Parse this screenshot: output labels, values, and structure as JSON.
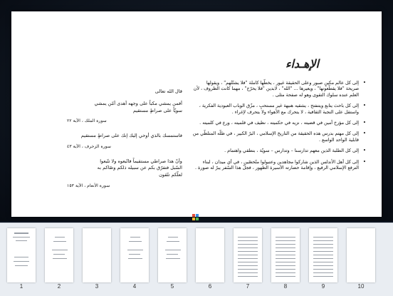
{
  "viewer": {
    "heading": "الإهـداء",
    "dedications": [
      "إلى كل عالم مكينٍ صبور وعلى الحقيقة غيور ، يخطّها كاملة \"فلا يشتّتُهم\" ، ويقولها صريحة \"فلا يقطّعونها\" ، ويعيرها ... \"الله\" ، لابدين \"فلا يحرّج\" ، مهما كانت الظروف ، لأن العلم عنده سلوك التقوى وهو له صفحة مثلى .",
      "إلى كل باحث يتابع ويتنفتح ، يشقيه هنيهة غير مستحبٍ ، مزّق الوباب العبودية الفكرية ، واستقل على النجبة الثقافية ، لا يتحرك مع الأهواء ولا يتحرف لإغراء .",
      "إلى كل مؤرخ أمين في قضيته ، نزيه في حكميته ، نظيف في قلميته ، ورع في كلميته .",
      "إلى كل مهتم بدرس هذه الحقيقة من التاريخ الإسلامي ، البرّ الكبير ، في ظلّه المتلظّي من قابلية الواحد الواسع .",
      "إلى كل الطلبة الذين معهم تدارسنا – وتدارس – سويّة ، بنطقي واهتمام .",
      "إلى كل أهل الأندلس الذين شاركوا مجاهدين وعتبولوا متّحصّين ، في أي ميدان ، لبناء الترفع الإسلامي الرفيع ، وإقامة حضارته الأسيرة الظهور ، فجلّ هذا السّفر يبرّ له صورة ."
    ],
    "quote_intro": "قال الله تعالى",
    "verses": [
      {
        "text": "أفمن يمشي مكباً على وجهه أهدى أمّن يمشي\nسويّاً على صراطٍ مستقيم",
        "cite": "سورة الملك ، الآية ٢٢"
      },
      {
        "text": "فاستمسك بالذي أوحي إليك إنك على صراطٍ مستقيم",
        "cite": "سورة الزخرف ، الآية ٤٣"
      },
      {
        "text": "وأنّ هذا صراطي مستقيماً فاتّبعوه ولا تتّبعوا\nالسّبل فتفرّق بكم عن سبيله ذلكم وصّاكم به\nلعلّكم تتّقون",
        "cite": "سورة الأنعام ، الآية ١٥٣"
      }
    ]
  },
  "view_toggle_icon": "grid-icon",
  "colors": {
    "strip_bg": "#e9edf2",
    "viewer_bg": "#0c121b"
  },
  "thumbnails": [
    {
      "num": "1",
      "type": "cover"
    },
    {
      "num": "2",
      "type": "text"
    },
    {
      "num": "3",
      "type": "blank"
    },
    {
      "num": "4",
      "type": "text"
    },
    {
      "num": "5",
      "type": "text"
    },
    {
      "num": "6",
      "type": "blank"
    },
    {
      "num": "7",
      "type": "dense"
    },
    {
      "num": "8",
      "type": "dense"
    },
    {
      "num": "9",
      "type": "dense"
    },
    {
      "num": "10",
      "type": "blank"
    }
  ]
}
